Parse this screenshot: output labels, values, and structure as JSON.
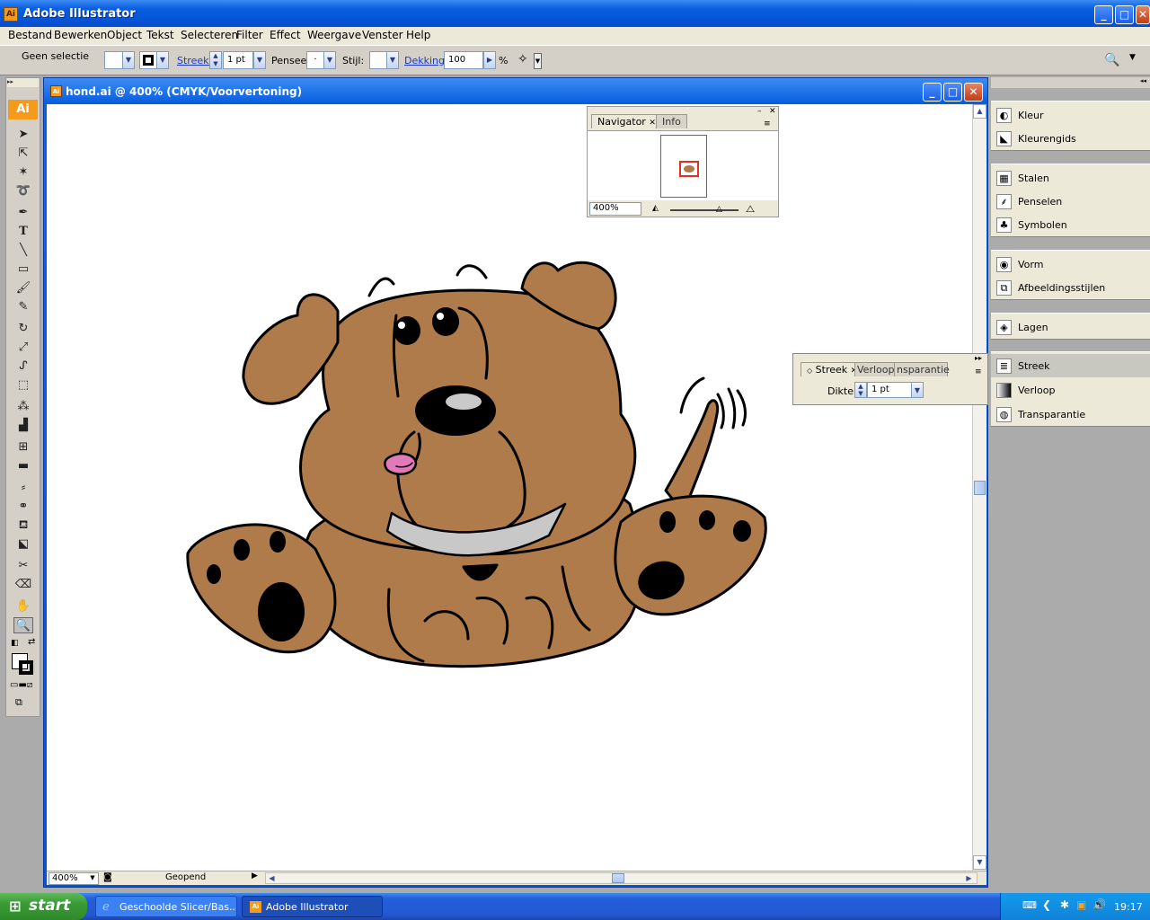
{
  "app": {
    "title": "Adobe Illustrator",
    "logo": "Ai"
  },
  "menu": [
    "Bestand",
    "Bewerken",
    "Object",
    "Tekst",
    "Selecteren",
    "Filter",
    "Effect",
    "Weergave",
    "Venster",
    "Help"
  ],
  "control": {
    "selection_label": "Geen selectie",
    "stroke_label": "Streek:",
    "stroke_value": "1 pt",
    "brush_label": "Penseel:",
    "brush_value": "·",
    "style_label": "Stijl:",
    "opacity_label": "Dekking:",
    "opacity_value": "100",
    "opacity_unit": "%"
  },
  "document": {
    "title": "hond.ai @ 400% (CMYK/Voorvertoning)",
    "zoom": "400%",
    "status": "Geopend"
  },
  "navigator": {
    "tabs": [
      "Navigator",
      "Info"
    ],
    "zoom": "400%"
  },
  "stroke_panel": {
    "tabs": [
      "Streek",
      "Verloop",
      "nsparantie"
    ],
    "weight_label": "Dikte:",
    "weight_value": "1 pt"
  },
  "dock": {
    "group1": [
      "Kleur",
      "Kleurengids"
    ],
    "group2": [
      "Stalen",
      "Penselen",
      "Symbolen"
    ],
    "group3": [
      "Vorm",
      "Afbeeldingsstijlen"
    ],
    "group4": [
      "Lagen"
    ],
    "group5": [
      "Streek",
      "Verloop",
      "Transparantie"
    ]
  },
  "taskbar": {
    "start": "start",
    "items": [
      "Geschoolde Slicer/Bas...",
      "Adobe Illustrator"
    ],
    "clock": "19:17"
  },
  "colors": {
    "dog_fill": "#b07b4a",
    "collar": "#c8c8c8",
    "tongue": "#e07ab8",
    "titlebar": "#0553d6",
    "start": "#3a9a35"
  }
}
